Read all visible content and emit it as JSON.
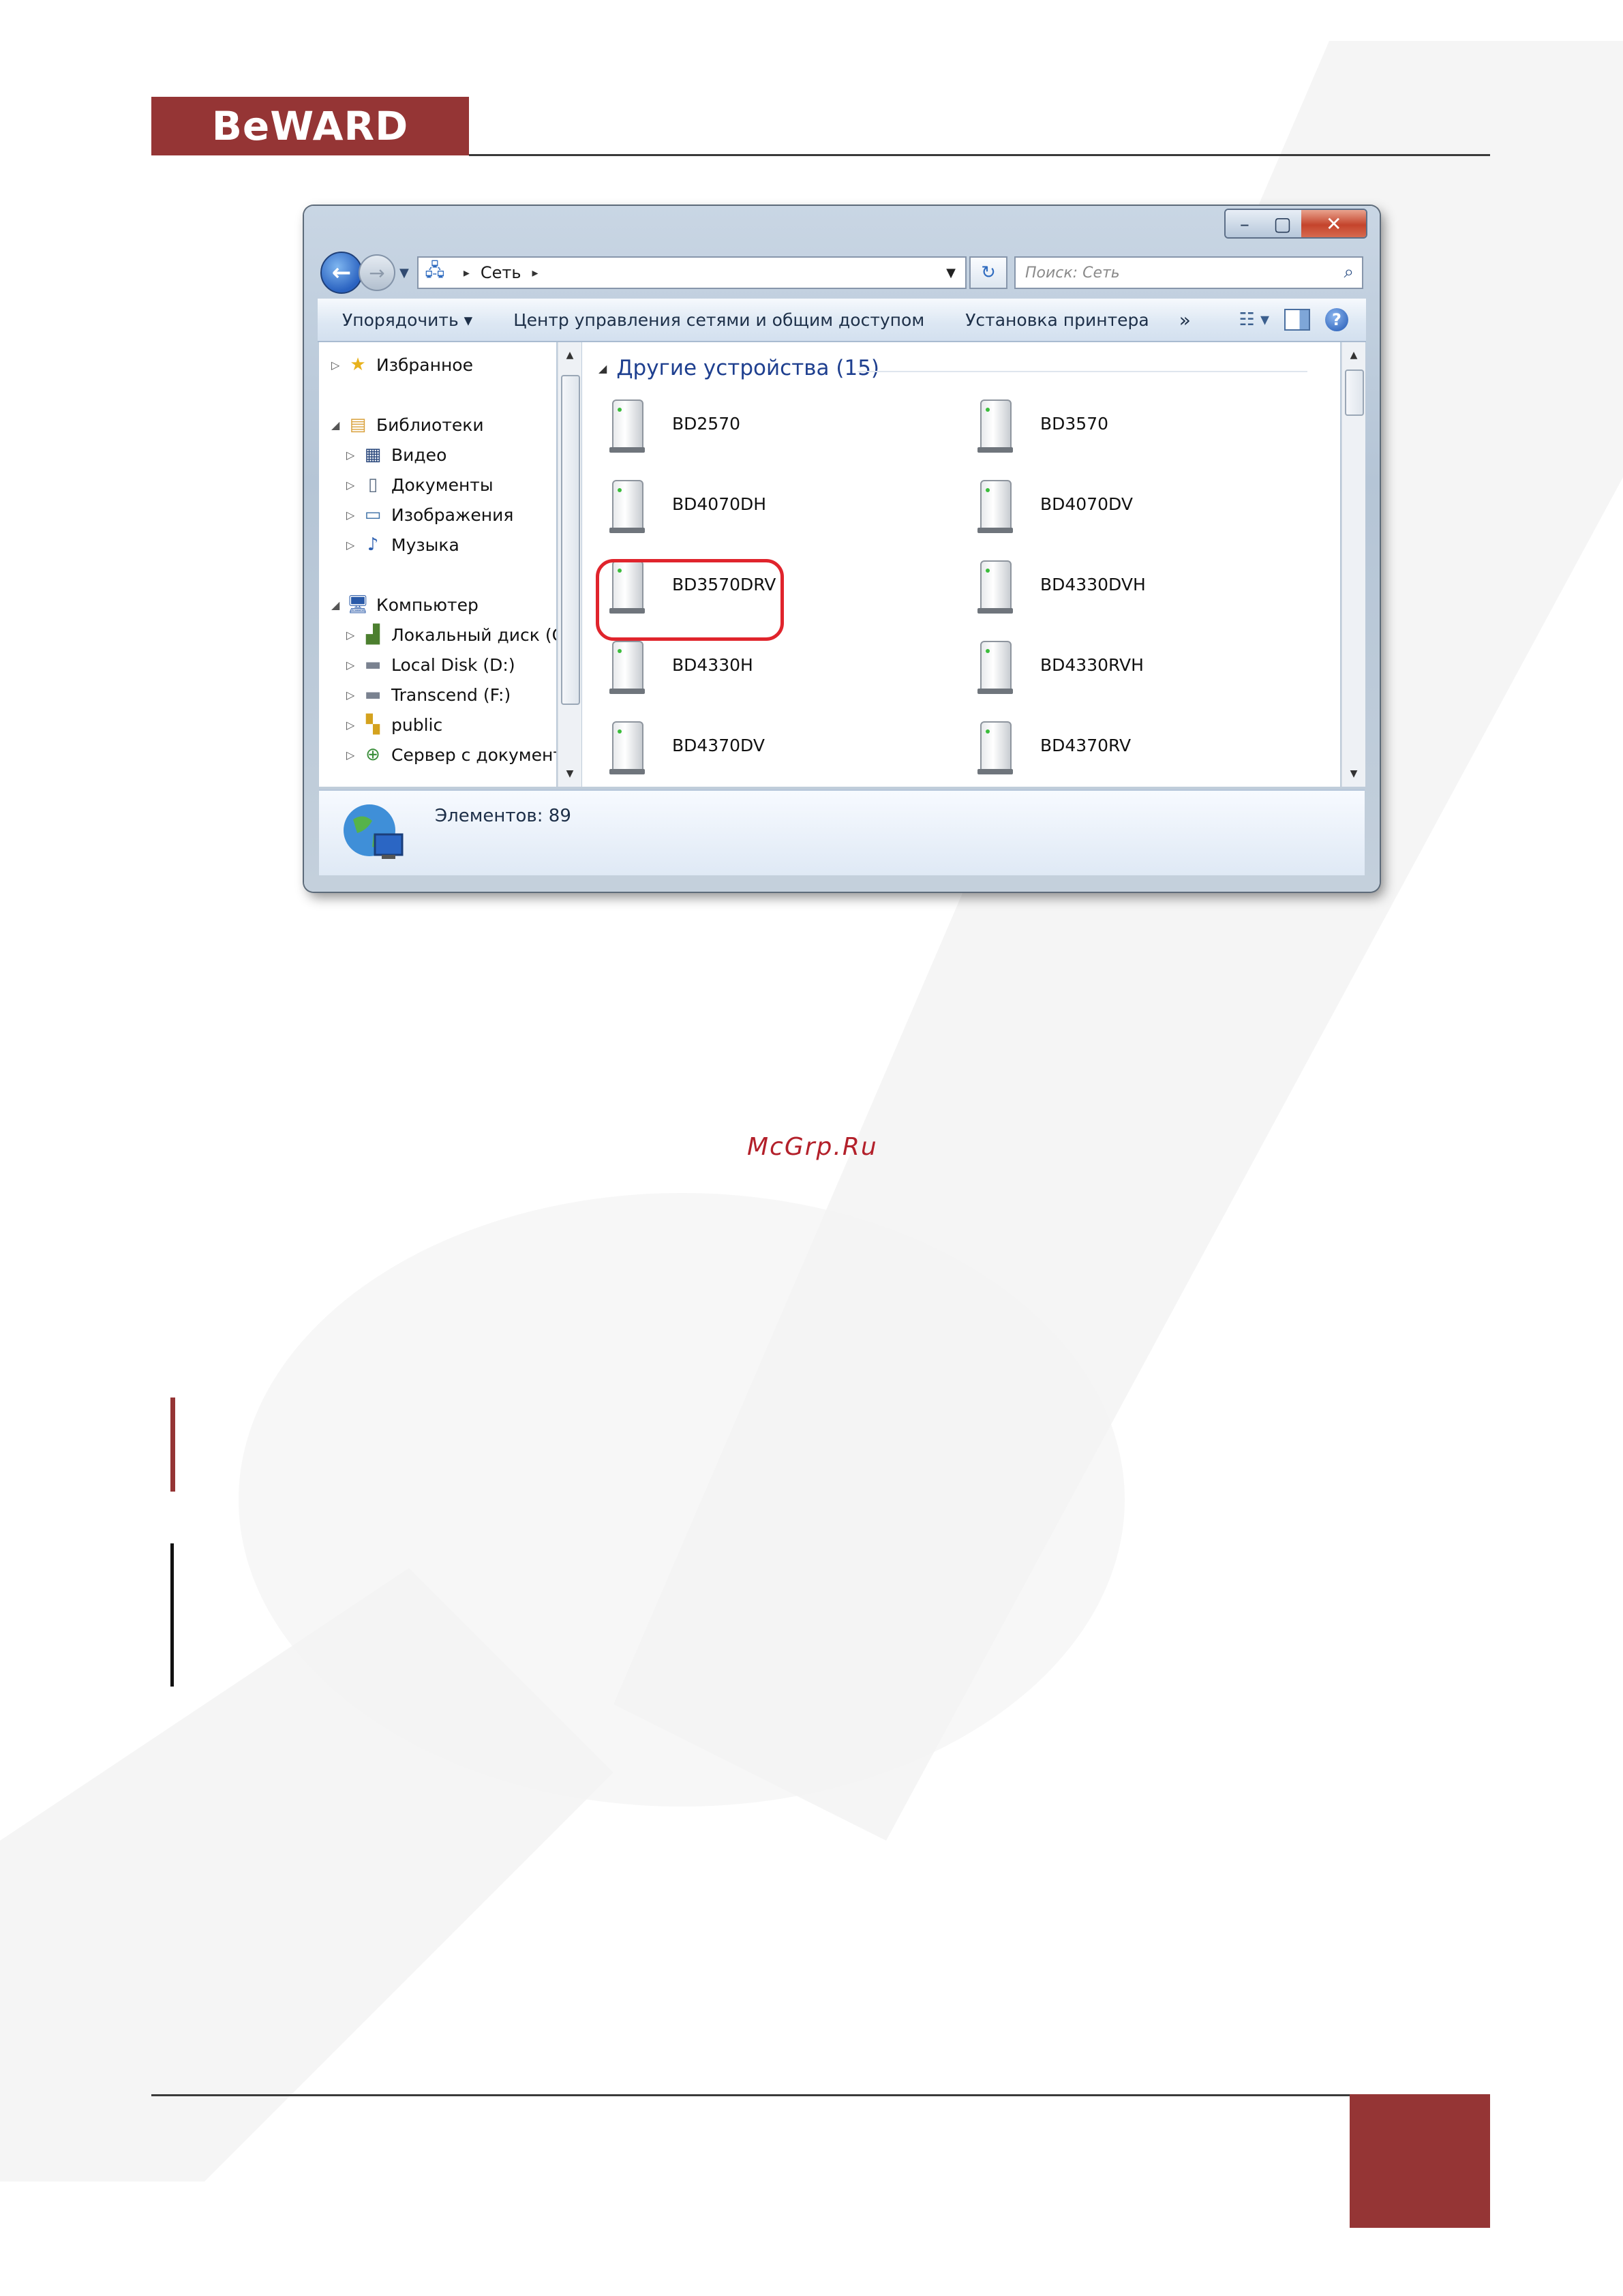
{
  "header": {
    "logo_text": "BeWARD"
  },
  "window": {
    "controls": {
      "minimize": "–",
      "maximize": "▢",
      "close": "✕"
    },
    "address": {
      "crumb": "Сеть"
    },
    "search": {
      "placeholder": "Поиск: Сеть"
    },
    "toolbar": {
      "organize": "Упорядочить ▾",
      "network_center": "Центр управления сетями и общим доступом",
      "printer_setup": "Установка принтера",
      "more": "»"
    },
    "nav_pane": {
      "items": [
        {
          "label": "Избранное",
          "icon": "star-icon"
        },
        {
          "label": "Библиотеки",
          "icon": "libraries-icon"
        },
        {
          "label": "Видео",
          "icon": "video-icon"
        },
        {
          "label": "Документы",
          "icon": "documents-icon"
        },
        {
          "label": "Изображения",
          "icon": "pictures-icon"
        },
        {
          "label": "Музыка",
          "icon": "music-icon"
        },
        {
          "label": "Компьютер",
          "icon": "computer-icon"
        },
        {
          "label": "Локальный диск (C",
          "icon": "local-disk-icon"
        },
        {
          "label": "Local Disk (D:)",
          "icon": "disk-icon"
        },
        {
          "label": "Transcend (F:)",
          "icon": "disk-icon"
        },
        {
          "label": "public",
          "icon": "user-folder-icon"
        },
        {
          "label": "Сервер с документ",
          "icon": "server-icon"
        }
      ]
    },
    "group_title": "Другие устройства (15)",
    "devices": [
      "BD2570",
      "BD3570",
      "BD4070DH",
      "BD4070DV",
      "BD3570DRV",
      "BD4330DVH",
      "BD4330H",
      "BD4330RVH",
      "BD4370DV",
      "BD4370RV"
    ],
    "highlighted_device": "BD3570DRV",
    "status": "Элементов: 89"
  },
  "watermark_text": "McGrp.Ru",
  "colors": {
    "brand": "#953535",
    "highlight": "#e0242c",
    "group_title": "#1e3f8f"
  }
}
